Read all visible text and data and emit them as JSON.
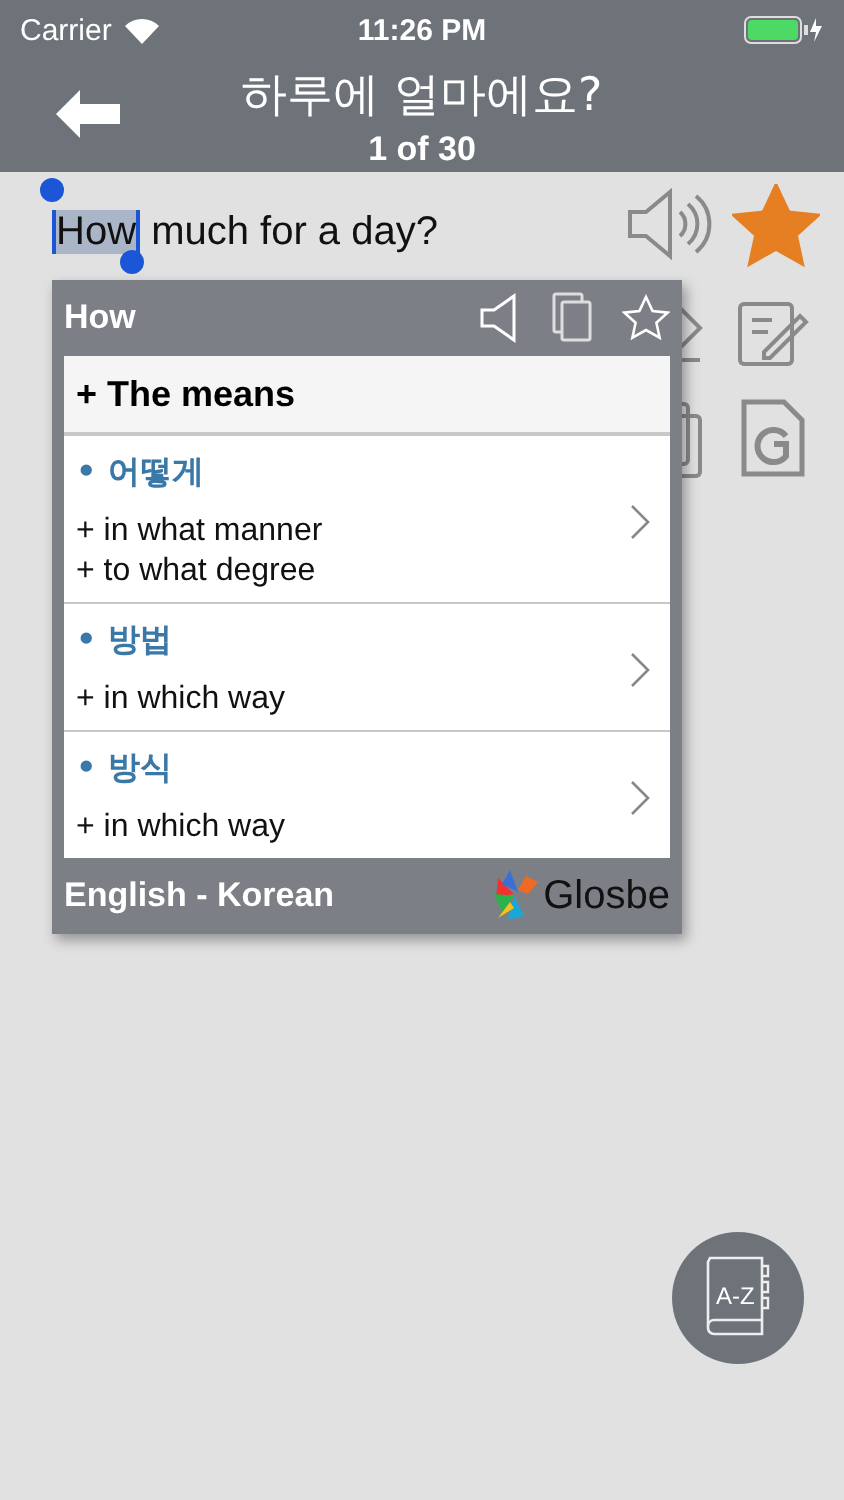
{
  "status_bar": {
    "carrier": "Carrier",
    "time": "11:26 PM"
  },
  "nav": {
    "title": "하루에 얼마에요?",
    "subtitle": "1 of 30"
  },
  "sentence": {
    "selected_word": "How",
    "rest": " much for a day?",
    "starred": true
  },
  "popup": {
    "word": "How",
    "heading": "+ The means",
    "entries": [
      {
        "term": "• 어떻게",
        "meanings": [
          "+ in what manner",
          "+ to what degree"
        ]
      },
      {
        "term": "• 방법",
        "meanings": [
          "+ in which way"
        ]
      },
      {
        "term": "• 방식",
        "meanings": [
          "+ in which way"
        ]
      }
    ],
    "language": "English - Korean",
    "brand": "Glosbe"
  },
  "dictionary_button": {
    "label": "A-Z"
  }
}
